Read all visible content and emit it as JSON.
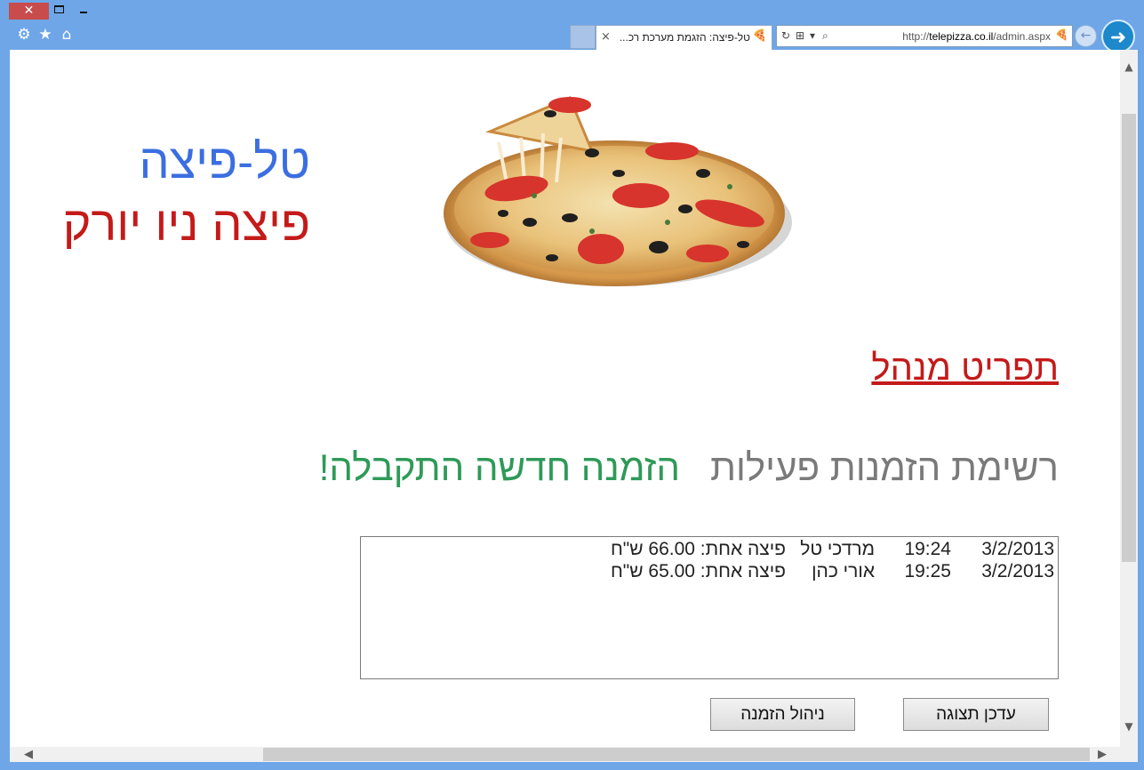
{
  "window": {
    "close_glyph": "✕",
    "max_glyph": "",
    "min_glyph": ""
  },
  "toolbar": {
    "tools_icon": "⚙",
    "favorites_icon": "★",
    "home_icon": "⌂"
  },
  "tab": {
    "close_glyph": "×",
    "title": "טל-פיצה: הזגמת מערכת רכ...",
    "favicon": "🍕"
  },
  "address": {
    "refresh_icon": "↻",
    "compat_icon": "⊞",
    "dropdown_icon": "▾",
    "search_icon": "⌕",
    "url_prefix": "http://",
    "url_host": "telepizza.co.il",
    "url_path": "/admin.aspx",
    "favicon": "🍕"
  },
  "nav": {
    "back_glyph": "←",
    "forward_glyph": "➜"
  },
  "brand": {
    "title": "טל-פיצה",
    "subtitle": "פיצה ניו יורק",
    "title_color": "#3b6ee0",
    "subtitle_color": "#c41a1a"
  },
  "page": {
    "admin_menu_link": "תפריט מנהל",
    "active_orders_heading": "רשימת הזמנות פעילות",
    "new_order_alert": "הזמנה חדשה התקבלה!",
    "alert_color": "#2e9a58"
  },
  "orders": [
    {
      "date": "3/2/2013",
      "time": "19:24",
      "name": "מרדכי טל",
      "description": "פיצה אחת: 66.00 ש\"ח"
    },
    {
      "date": "3/2/2013",
      "time": "19:25",
      "name": "אורי כהן",
      "description": "פיצה אחת: 65.00 ש\"ח"
    }
  ],
  "buttons": {
    "refresh_label": "עדכן תצוגה",
    "manage_label": "ניהול הזמנה"
  },
  "scrollbars": {
    "up": "▲",
    "down": "▼",
    "left": "◀",
    "right": "▶"
  }
}
